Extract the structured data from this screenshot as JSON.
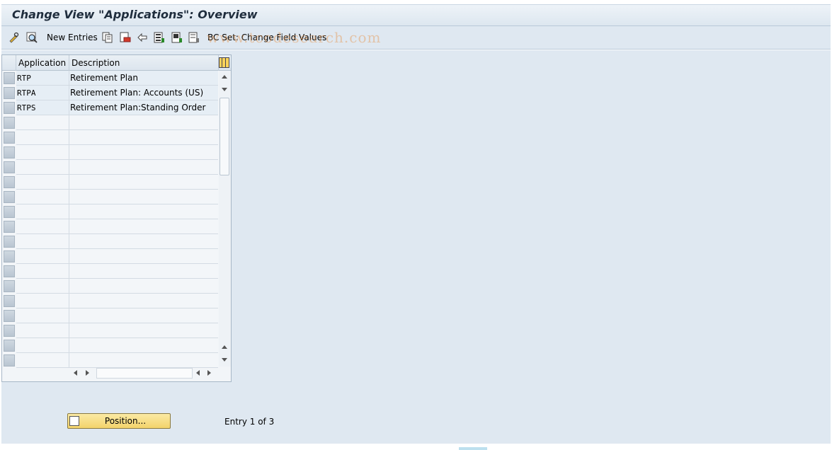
{
  "window": {
    "title": "Change View \"Applications\": Overview"
  },
  "toolbar": {
    "new_entries_label": "New Entries",
    "bc_set_label": "BC Set: Change Field Values",
    "watermark": "www.tcodesearch.com",
    "icons": [
      "display-change-icon",
      "details-icon",
      "copy-icon",
      "delete-icon",
      "undo-icon",
      "select-all-icon",
      "select-block-icon",
      "deselect-all-icon"
    ]
  },
  "table": {
    "columns": [
      "Application",
      "Description"
    ],
    "rows": [
      {
        "application": "RTP",
        "description": "Retirement Plan"
      },
      {
        "application": "RTPA",
        "description": "Retirement Plan: Accounts (US)"
      },
      {
        "application": "RTPS",
        "description": "Retirement Plan:Standing Order"
      }
    ],
    "visible_row_count": 20
  },
  "footer": {
    "position_button_label": "Position...",
    "entry_info": "Entry 1 of 3"
  },
  "colors": {
    "toolbar_bg": "#dfe8f1",
    "button_yellow": "#f3d36b"
  }
}
